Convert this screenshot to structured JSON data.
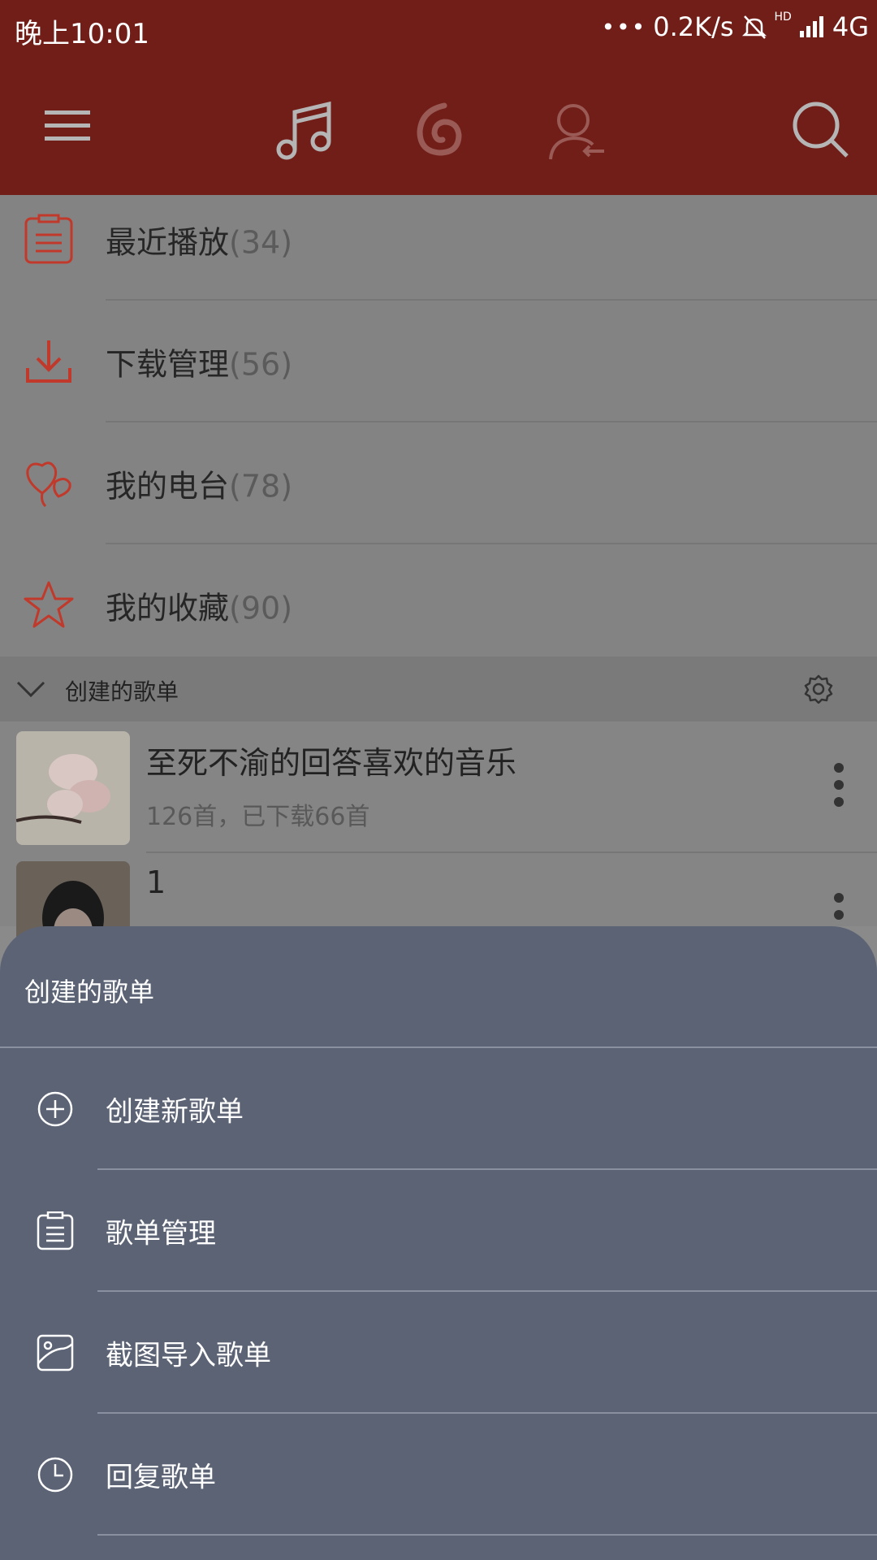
{
  "status_bar": {
    "time": "晚上10:01",
    "network_speed": "0.2K/s",
    "signal_label": "4G",
    "hd_label": "HD",
    "icons": [
      "dots-icon",
      "muted-bell-icon",
      "signal-icon"
    ]
  },
  "toolbar": {
    "icons": [
      "menu-icon",
      "music-note-icon",
      "netease-icon",
      "friends-icon",
      "search-icon"
    ]
  },
  "main_list": [
    {
      "label": "最近播放",
      "count": "(34)",
      "icon": "recent-list-icon"
    },
    {
      "label": "下载管理",
      "count": "(56)",
      "icon": "download-icon"
    },
    {
      "label": "我的电台",
      "count": "(78)",
      "icon": "radio-heart-icon"
    },
    {
      "label": "我的收藏",
      "count": "(90)",
      "icon": "star-icon"
    }
  ],
  "section_header": {
    "title": "创建的歌单",
    "icons": [
      "chevron-down-icon",
      "gear-icon"
    ]
  },
  "playlists": [
    {
      "name": "至死不渝的回答喜欢的音乐",
      "subtitle": "126首，已下载66首"
    },
    {
      "name": "1",
      "subtitle": ""
    }
  ],
  "sheet": {
    "title": "创建的歌单",
    "items": [
      {
        "label": "创建新歌单",
        "icon": "plus-circle-icon"
      },
      {
        "label": "歌单管理",
        "icon": "clipboard-icon"
      },
      {
        "label": "截图导入歌单",
        "icon": "image-import-icon"
      },
      {
        "label": "回复歌单",
        "icon": "clock-icon"
      }
    ]
  },
  "colors": {
    "toolbar_bg": "#711e19",
    "progress_green": "#3fc21a",
    "sheet_bg": "#5b6375",
    "icon_red": "#c0392b"
  }
}
